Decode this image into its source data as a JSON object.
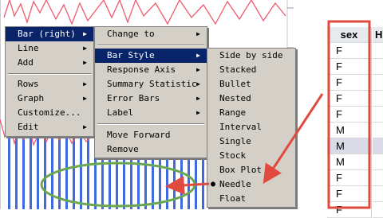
{
  "context_menu": {
    "items": [
      {
        "label": "Bar (right)",
        "arrow": "▶",
        "highlighted": true
      },
      {
        "label": "Line",
        "arrow": "▶"
      },
      {
        "label": "Add",
        "arrow": "▶"
      },
      {
        "label": "Rows",
        "arrow": "▶"
      },
      {
        "label": "Graph",
        "arrow": "▶"
      },
      {
        "label": "Customize...",
        "arrow": ""
      },
      {
        "label": "Edit",
        "arrow": "▶"
      }
    ]
  },
  "submenu": {
    "items": [
      {
        "label": "Change to",
        "arrow": "▶"
      },
      {
        "label": "Bar Style",
        "arrow": "▶",
        "highlighted": true
      },
      {
        "label": "Response Axis",
        "arrow": "▶"
      },
      {
        "label": "Summary Statistic",
        "arrow": "▶"
      },
      {
        "label": "Error Bars",
        "arrow": "▶"
      },
      {
        "label": "Label",
        "arrow": "▶"
      },
      {
        "label": "Move Forward",
        "arrow": ""
      },
      {
        "label": "Remove",
        "arrow": ""
      }
    ]
  },
  "bar_style_menu": {
    "items": [
      "Side by side",
      "Stacked",
      "Bullet",
      "Nested",
      "Range",
      "Interval",
      "Single",
      "Stock",
      "Box Plot",
      "Needle",
      "Float"
    ],
    "selected": "Needle",
    "bullet_glyph": "●"
  },
  "data_grid": {
    "header": "sex",
    "next_header": "H",
    "rows": [
      "F",
      "F",
      "F",
      "F",
      "F",
      "M",
      "M",
      "M",
      "F",
      "F",
      "F"
    ],
    "selected_row": 6
  },
  "colors": {
    "bars": "#4169e1",
    "line": "#f05a6e",
    "menu_bg": "#d4d0c8",
    "highlight": "#0a246a",
    "annotation_red": "#e04a3f",
    "annotation_green": "#6aa84f",
    "grid_header": "#e8ebee",
    "selected_row": "#d9dbe6"
  }
}
